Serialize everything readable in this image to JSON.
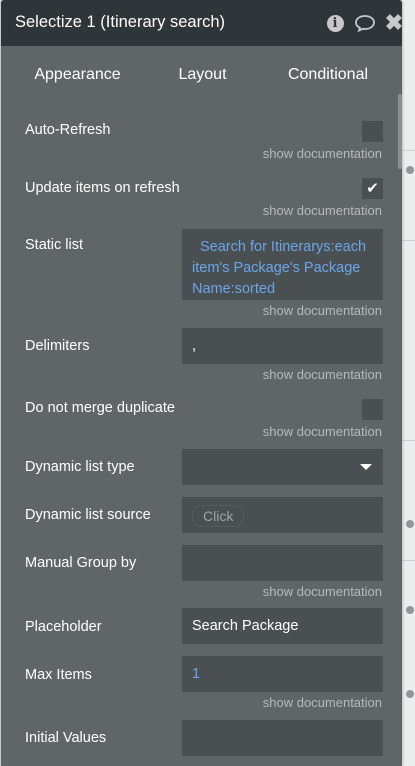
{
  "panel": {
    "title": "Selectize 1 (Itinerary search)",
    "icons": [
      "info-icon",
      "comment-icon",
      "close-icon"
    ]
  },
  "tabs": [
    {
      "label": "Appearance",
      "active": true
    },
    {
      "label": "Layout",
      "active": false
    },
    {
      "label": "Conditional",
      "active": false
    }
  ],
  "doc_link": "show documentation",
  "fields": {
    "auto_refresh": {
      "label": "Auto-Refresh",
      "checked": false
    },
    "update_items": {
      "label": "Update items on refresh",
      "checked": true
    },
    "static_list": {
      "label": "Static list",
      "value": "Search for Itinerarys:each item's Package's Package Name:sorted"
    },
    "delimiters": {
      "label": "Delimiters",
      "value": ","
    },
    "no_merge": {
      "label": "Do not merge duplicate",
      "checked": false
    },
    "dynamic_type": {
      "label": "Dynamic list type",
      "value": ""
    },
    "dynamic_source": {
      "label": "Dynamic list source",
      "button": "Click"
    },
    "manual_group": {
      "label": "Manual Group by",
      "value": ""
    },
    "placeholder": {
      "label": "Placeholder",
      "value": "Search Package"
    },
    "max_items": {
      "label": "Max Items",
      "value": "1"
    },
    "initial_values": {
      "label": "Initial Values",
      "value": ""
    }
  },
  "colors": {
    "panel_bg": "#606568",
    "titlebar_bg": "#2f3639",
    "field_bg": "#4a4f52",
    "dynamic_text": "#6aa6e8"
  }
}
